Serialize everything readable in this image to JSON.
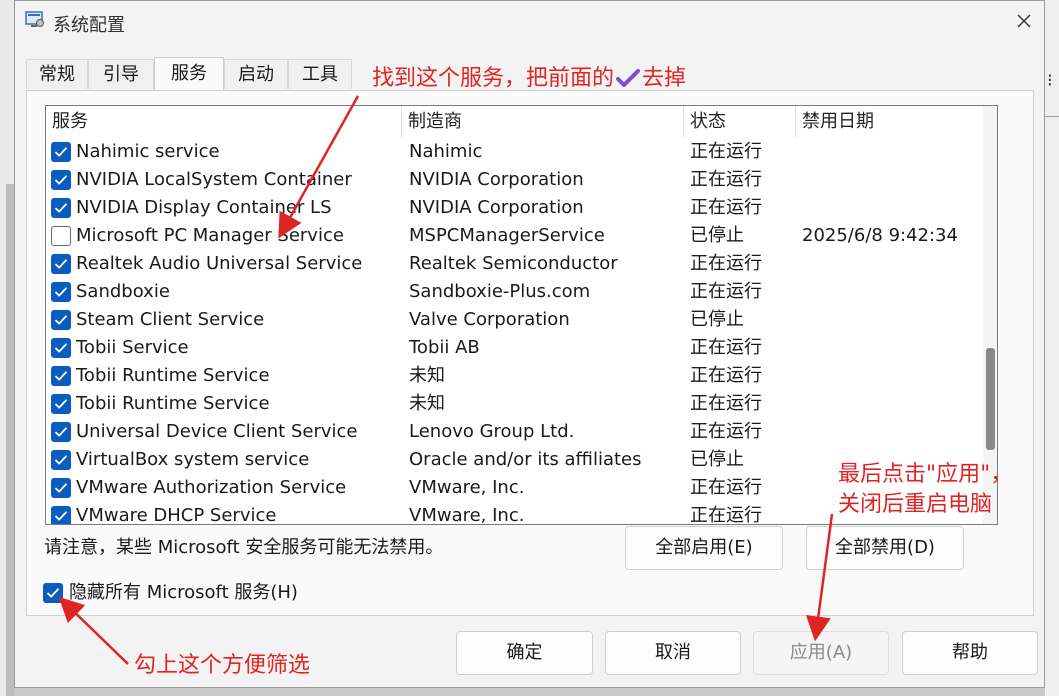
{
  "window": {
    "title": "系统配置",
    "icon_name": "msconfig-icon",
    "close_icon": "close-icon"
  },
  "tabs": [
    {
      "label": "常规",
      "active": false
    },
    {
      "label": "引导",
      "active": false
    },
    {
      "label": "服务",
      "active": true
    },
    {
      "label": "启动",
      "active": false
    },
    {
      "label": "工具",
      "active": false
    }
  ],
  "services": {
    "columns": [
      "服务",
      "制造商",
      "状态",
      "禁用日期"
    ],
    "rows": [
      {
        "checked": true,
        "name": "Nahimic service",
        "maker": "Nahimic",
        "status": "正在运行",
        "date": ""
      },
      {
        "checked": true,
        "name": "NVIDIA LocalSystem Container",
        "maker": "NVIDIA Corporation",
        "status": "正在运行",
        "date": ""
      },
      {
        "checked": true,
        "name": "NVIDIA Display Container LS",
        "maker": "NVIDIA Corporation",
        "status": "正在运行",
        "date": ""
      },
      {
        "checked": false,
        "name": "Microsoft PC Manager Service",
        "maker": "MSPCManagerService",
        "status": "已停止",
        "date": "2025/6/8 9:42:34"
      },
      {
        "checked": true,
        "name": "Realtek Audio Universal Service",
        "maker": "Realtek Semiconductor",
        "status": "正在运行",
        "date": ""
      },
      {
        "checked": true,
        "name": "Sandboxie",
        "maker": "Sandboxie-Plus.com",
        "status": "正在运行",
        "date": ""
      },
      {
        "checked": true,
        "name": "Steam Client Service",
        "maker": "Valve Corporation",
        "status": "已停止",
        "date": ""
      },
      {
        "checked": true,
        "name": "Tobii Service",
        "maker": "Tobii AB",
        "status": "正在运行",
        "date": ""
      },
      {
        "checked": true,
        "name": "Tobii Runtime Service",
        "maker": "未知",
        "status": "正在运行",
        "date": ""
      },
      {
        "checked": true,
        "name": "Tobii Runtime Service",
        "maker": "未知",
        "status": "正在运行",
        "date": ""
      },
      {
        "checked": true,
        "name": "Universal Device Client Service",
        "maker": "Lenovo Group Ltd.",
        "status": "正在运行",
        "date": ""
      },
      {
        "checked": true,
        "name": "VirtualBox system service",
        "maker": "Oracle and/or its affiliates",
        "status": "已停止",
        "date": ""
      },
      {
        "checked": true,
        "name": "VMware Authorization Service",
        "maker": "VMware, Inc.",
        "status": "正在运行",
        "date": ""
      },
      {
        "checked": true,
        "name": "VMware DHCP Service",
        "maker": "VMware, Inc.",
        "status": "正在运行",
        "date": ""
      }
    ]
  },
  "notice": "请注意，某些 Microsoft 安全服务可能无法禁用。",
  "enable_all": "全部启用(E)",
  "disable_all": "全部禁用(D)",
  "hide_ms": {
    "checked": true,
    "label": "隐藏所有 Microsoft 服务(H)"
  },
  "footer": {
    "ok": "确定",
    "cancel": "取消",
    "apply": "应用(A)",
    "help": "帮助"
  },
  "annotations": {
    "find_service_prefix": "找到这个服务，把前面的",
    "find_service_suffix": "去掉",
    "apply_line1": "最后点击\"应用\"，",
    "apply_line2": "关闭后重启电脑",
    "check_hint": "勾上这个方便筛选",
    "color": "#e02424",
    "check_color": "#7a4fd6"
  },
  "colors": {
    "checkbox_blue": "#0b5cc0"
  }
}
